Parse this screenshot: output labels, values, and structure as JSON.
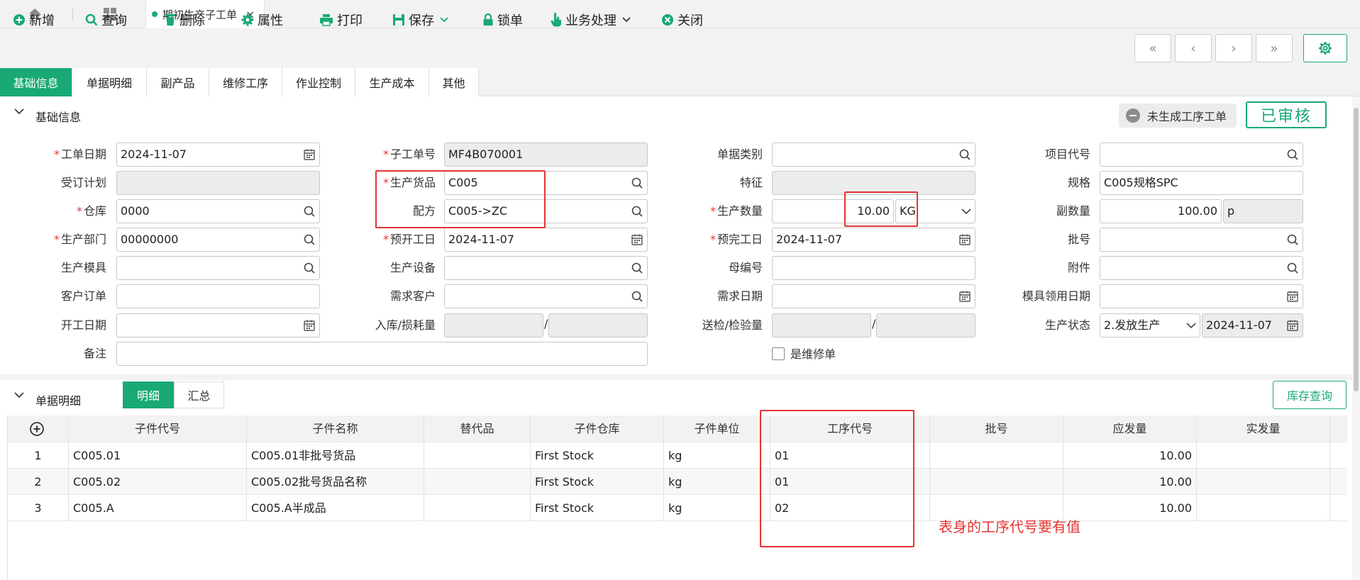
{
  "window": {
    "tab_title": "期初生产子工单",
    "tab_close": "×"
  },
  "toolbar": {
    "new": "新增",
    "query": "查询",
    "delete": "删除",
    "properties": "属性",
    "print": "打印",
    "save": "保存",
    "lock": "锁单",
    "business": "业务处理",
    "close": "关闭"
  },
  "nav": {
    "first": "«",
    "prev": "‹",
    "next": "›",
    "last": "»"
  },
  "form_tabs": [
    "基础信息",
    "单据明细",
    "副产品",
    "维修工序",
    "作业控制",
    "生产成本",
    "其他"
  ],
  "basic_section": {
    "title": "基础信息",
    "status_pill": "未生成工序工单",
    "audit_stamp": "已审核"
  },
  "fields": {
    "work_date": {
      "label": "工单日期",
      "value": "2024-11-07"
    },
    "sub_order_no": {
      "label": "子工单号",
      "value": "MF4B070001"
    },
    "doc_category": {
      "label": "单据类别",
      "value": ""
    },
    "project_code": {
      "label": "项目代号",
      "value": ""
    },
    "order_plan": {
      "label": "受订计划",
      "value": ""
    },
    "product": {
      "label": "生产货品",
      "value": "C005"
    },
    "feature": {
      "label": "特征",
      "value": ""
    },
    "spec": {
      "label": "规格",
      "value": "C005规格SPC"
    },
    "warehouse": {
      "label": "仓库",
      "value": "0000"
    },
    "formula": {
      "label": "配方",
      "value": "C005->ZC"
    },
    "quantity": {
      "label": "生产数量",
      "value": "10.00",
      "unit": "KG"
    },
    "sub_quantity": {
      "label": "副数量",
      "value": "100.00",
      "unit": "p"
    },
    "department": {
      "label": "生产部门",
      "value": "00000000"
    },
    "plan_start": {
      "label": "预开工日",
      "value": "2024-11-07"
    },
    "plan_finish": {
      "label": "预完工日",
      "value": "2024-11-07"
    },
    "batch_no": {
      "label": "批号",
      "value": ""
    },
    "mold": {
      "label": "生产模具",
      "value": ""
    },
    "equipment": {
      "label": "生产设备",
      "value": ""
    },
    "parent_no": {
      "label": "母编号",
      "value": ""
    },
    "attachment": {
      "label": "附件",
      "value": ""
    },
    "customer_order": {
      "label": "客户订单",
      "value": ""
    },
    "demand_customer": {
      "label": "需求客户",
      "value": ""
    },
    "demand_date": {
      "label": "需求日期",
      "value": ""
    },
    "mold_receive_date": {
      "label": "模具领用日期",
      "value": ""
    },
    "start_date": {
      "label": "开工日期",
      "value": ""
    },
    "in_loss": {
      "label": "入库/损耗量",
      "value1": "",
      "value2": ""
    },
    "inspect_qty": {
      "label": "送检/检验量",
      "value1": "",
      "value2": ""
    },
    "prod_status": {
      "label": "生产状态",
      "value": "2.发放生产",
      "date": "2024-11-07"
    },
    "remark": {
      "label": "备注",
      "value": ""
    },
    "is_repair": {
      "label": "是维修单",
      "checked": false
    }
  },
  "detail_section": {
    "title": "单据明细",
    "seg_detail": "明细",
    "seg_summary": "汇总",
    "stock_query": "库存查询"
  },
  "grid": {
    "columns": [
      "子件代号",
      "子件名称",
      "替代品",
      "子件仓库",
      "子件单位",
      "工序代号",
      "批号",
      "应发量",
      "实发量"
    ],
    "rows": [
      {
        "no": "1",
        "code": "C005.01",
        "name": "C005.01非批号货品",
        "sub": "",
        "wh": "First Stock",
        "unit": "kg",
        "proc": "01",
        "batch": "",
        "qty": "10.00",
        "actual": ""
      },
      {
        "no": "2",
        "code": "C005.02",
        "name": "C005.02批号货品名称",
        "sub": "",
        "wh": "First Stock",
        "unit": "kg",
        "proc": "01",
        "batch": "",
        "qty": "10.00",
        "actual": ""
      },
      {
        "no": "3",
        "code": "C005.A",
        "name": "C005.A半成品",
        "sub": "",
        "wh": "First Stock",
        "unit": "kg",
        "proc": "02",
        "batch": "",
        "qty": "10.00",
        "actual": ""
      }
    ]
  },
  "annotation": {
    "note": "表身的工序代号要有值"
  },
  "colors": {
    "accent": "#19a974",
    "highlight": "#e63333"
  }
}
